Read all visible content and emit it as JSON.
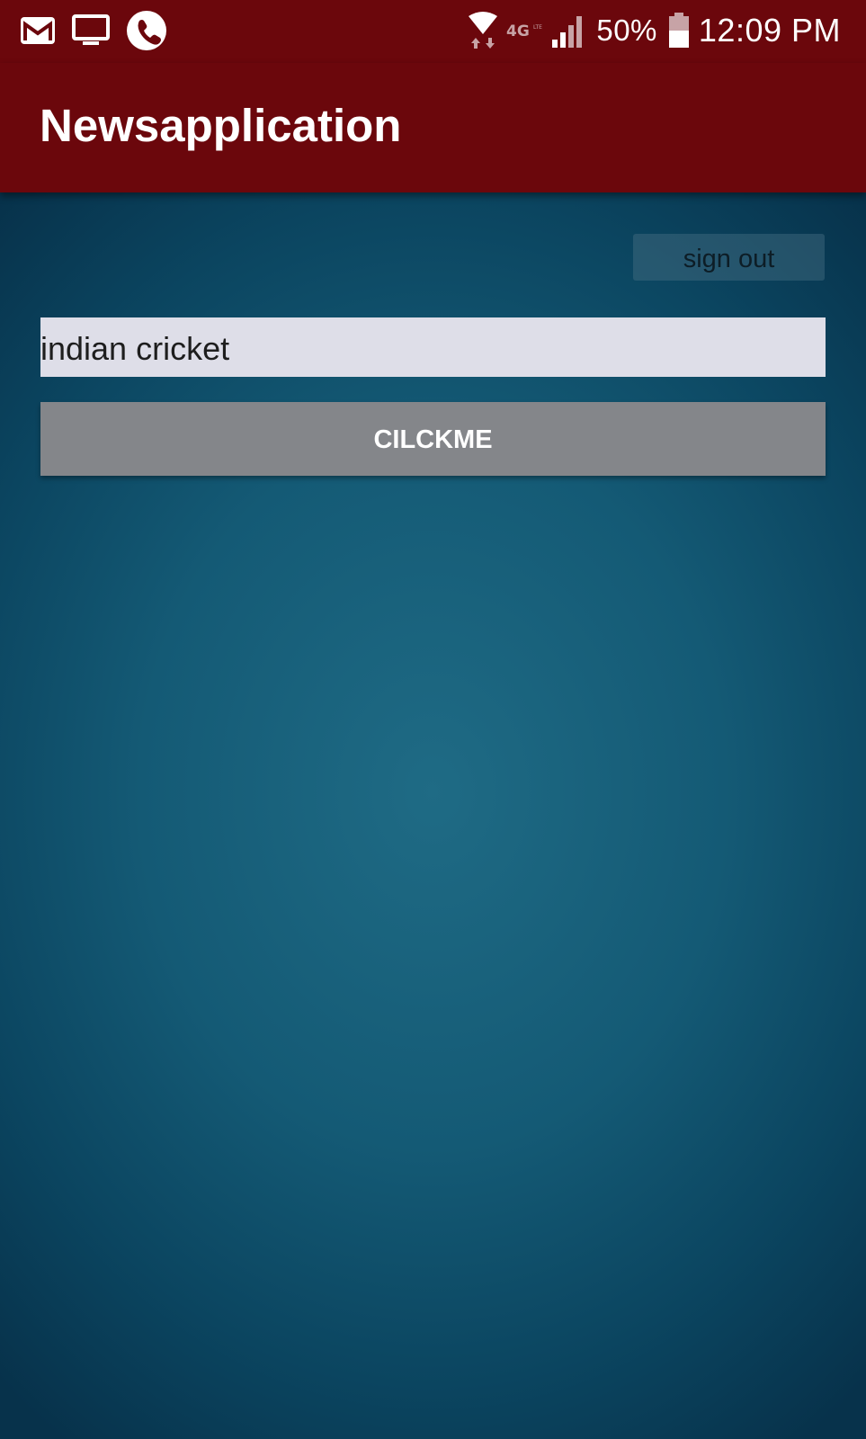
{
  "status_bar": {
    "icons_left": [
      "gmail-icon",
      "monitor-icon",
      "phone-icon"
    ],
    "icons_right": [
      "wifi-data-icon",
      "lte-4g-icon",
      "signal-icon",
      "battery-icon"
    ],
    "battery_percent": "50%",
    "time": "12:09 PM"
  },
  "app_bar": {
    "title": "Newsapplication",
    "color": "#6b070c"
  },
  "main": {
    "signout_label": "sign out",
    "search_value": "indian cricket",
    "button_label": "CILCKME"
  }
}
